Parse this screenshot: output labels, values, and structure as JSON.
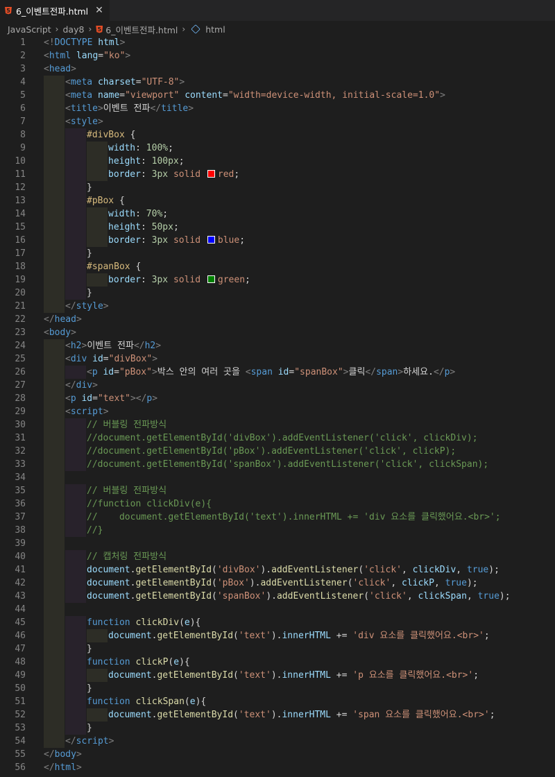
{
  "tab": {
    "filename": "6_이벤트전파.html",
    "icon": "html5-icon",
    "close": "✕"
  },
  "breadcrumb": {
    "items": [
      "JavaScript",
      "day8",
      "6_이벤트전파.html",
      "html"
    ]
  },
  "colors": {
    "red": "#ff0000",
    "blue": "#0000ff",
    "green": "#008000"
  },
  "lines": [
    {
      "n": "1",
      "ind": 0,
      "tokens": [
        [
          "p",
          "<!"
        ],
        [
          "t",
          "DOCTYPE "
        ],
        [
          "a",
          "html"
        ],
        [
          "p",
          ">"
        ]
      ]
    },
    {
      "n": "2",
      "ind": 0,
      "tokens": [
        [
          "p",
          "<"
        ],
        [
          "t",
          "html "
        ],
        [
          "a",
          "lang"
        ],
        [
          "w",
          "="
        ],
        [
          "s",
          "\"ko\""
        ],
        [
          "p",
          ">"
        ]
      ]
    },
    {
      "n": "3",
      "ind": 0,
      "tokens": [
        [
          "p",
          "<"
        ],
        [
          "t",
          "head"
        ],
        [
          "p",
          ">"
        ]
      ]
    },
    {
      "n": "4",
      "ind": 1,
      "tokens": [
        [
          "p",
          "<"
        ],
        [
          "t",
          "meta "
        ],
        [
          "a",
          "charset"
        ],
        [
          "w",
          "="
        ],
        [
          "s",
          "\"UTF-8\""
        ],
        [
          "p",
          ">"
        ]
      ]
    },
    {
      "n": "5",
      "ind": 1,
      "tokens": [
        [
          "p",
          "<"
        ],
        [
          "t",
          "meta "
        ],
        [
          "a",
          "name"
        ],
        [
          "w",
          "="
        ],
        [
          "s",
          "\"viewport\" "
        ],
        [
          "a",
          "content"
        ],
        [
          "w",
          "="
        ],
        [
          "s",
          "\"width=device-width, initial-scale=1.0\""
        ],
        [
          "p",
          ">"
        ]
      ]
    },
    {
      "n": "6",
      "ind": 1,
      "tokens": [
        [
          "p",
          "<"
        ],
        [
          "t",
          "title"
        ],
        [
          "p",
          ">"
        ],
        [
          "w",
          "이벤트 전파"
        ],
        [
          "p",
          "</"
        ],
        [
          "t",
          "title"
        ],
        [
          "p",
          ">"
        ]
      ]
    },
    {
      "n": "7",
      "ind": 1,
      "tokens": [
        [
          "p",
          "<"
        ],
        [
          "t",
          "style"
        ],
        [
          "p",
          ">"
        ]
      ]
    },
    {
      "n": "8",
      "ind": 2,
      "tokens": [
        [
          "sel",
          "#divBox "
        ],
        [
          "w",
          "{"
        ]
      ]
    },
    {
      "n": "9",
      "ind": 3,
      "tokens": [
        [
          "a",
          "width"
        ],
        [
          "w",
          ": "
        ],
        [
          "n",
          "100%"
        ],
        [
          "w",
          ";"
        ]
      ]
    },
    {
      "n": "10",
      "ind": 3,
      "tokens": [
        [
          "a",
          "height"
        ],
        [
          "w",
          ": "
        ],
        [
          "n",
          "100px"
        ],
        [
          "w",
          ";"
        ]
      ]
    },
    {
      "n": "11",
      "ind": 3,
      "tokens": [
        [
          "a",
          "border"
        ],
        [
          "w",
          ": "
        ],
        [
          "n",
          "3px "
        ],
        [
          "s",
          "solid "
        ],
        [
          "sw",
          "red"
        ],
        [
          "s",
          "red"
        ],
        [
          "w",
          ";"
        ]
      ]
    },
    {
      "n": "12",
      "ind": 2,
      "tokens": [
        [
          "w",
          "}"
        ]
      ]
    },
    {
      "n": "13",
      "ind": 2,
      "tokens": [
        [
          "sel",
          "#pBox "
        ],
        [
          "w",
          "{"
        ]
      ]
    },
    {
      "n": "14",
      "ind": 3,
      "tokens": [
        [
          "a",
          "width"
        ],
        [
          "w",
          ": "
        ],
        [
          "n",
          "70%"
        ],
        [
          "w",
          ";"
        ]
      ]
    },
    {
      "n": "15",
      "ind": 3,
      "tokens": [
        [
          "a",
          "height"
        ],
        [
          "w",
          ": "
        ],
        [
          "n",
          "50px"
        ],
        [
          "w",
          ";"
        ]
      ]
    },
    {
      "n": "16",
      "ind": 3,
      "tokens": [
        [
          "a",
          "border"
        ],
        [
          "w",
          ": "
        ],
        [
          "n",
          "3px "
        ],
        [
          "s",
          "solid "
        ],
        [
          "sw",
          "blue"
        ],
        [
          "s",
          "blue"
        ],
        [
          "w",
          ";"
        ]
      ]
    },
    {
      "n": "17",
      "ind": 2,
      "tokens": [
        [
          "w",
          "}"
        ]
      ]
    },
    {
      "n": "18",
      "ind": 2,
      "tokens": [
        [
          "sel",
          "#spanBox "
        ],
        [
          "w",
          "{"
        ]
      ]
    },
    {
      "n": "19",
      "ind": 3,
      "tokens": [
        [
          "a",
          "border"
        ],
        [
          "w",
          ": "
        ],
        [
          "n",
          "3px "
        ],
        [
          "s",
          "solid "
        ],
        [
          "sw",
          "green"
        ],
        [
          "s",
          "green"
        ],
        [
          "w",
          ";"
        ]
      ]
    },
    {
      "n": "20",
      "ind": 2,
      "tokens": [
        [
          "w",
          "}"
        ]
      ]
    },
    {
      "n": "21",
      "ind": 1,
      "tokens": [
        [
          "p",
          "</"
        ],
        [
          "t",
          "style"
        ],
        [
          "p",
          ">"
        ]
      ]
    },
    {
      "n": "22",
      "ind": 0,
      "tokens": [
        [
          "p",
          "</"
        ],
        [
          "t",
          "head"
        ],
        [
          "p",
          ">"
        ]
      ]
    },
    {
      "n": "23",
      "ind": 0,
      "tokens": [
        [
          "p",
          "<"
        ],
        [
          "t",
          "body"
        ],
        [
          "p",
          ">"
        ]
      ]
    },
    {
      "n": "24",
      "ind": 1,
      "tokens": [
        [
          "p",
          "<"
        ],
        [
          "t",
          "h2"
        ],
        [
          "p",
          ">"
        ],
        [
          "w",
          "이벤트 전파"
        ],
        [
          "p",
          "</"
        ],
        [
          "t",
          "h2"
        ],
        [
          "p",
          ">"
        ]
      ]
    },
    {
      "n": "25",
      "ind": 1,
      "tokens": [
        [
          "p",
          "<"
        ],
        [
          "t",
          "div "
        ],
        [
          "a",
          "id"
        ],
        [
          "w",
          "="
        ],
        [
          "s",
          "\"divBox\""
        ],
        [
          "p",
          ">"
        ]
      ]
    },
    {
      "n": "26",
      "ind": 2,
      "tokens": [
        [
          "p",
          "<"
        ],
        [
          "t",
          "p "
        ],
        [
          "a",
          "id"
        ],
        [
          "w",
          "="
        ],
        [
          "s",
          "\"pBox\""
        ],
        [
          "p",
          ">"
        ],
        [
          "w",
          "박스 안의 여러 곳을 "
        ],
        [
          "p",
          "<"
        ],
        [
          "t",
          "span "
        ],
        [
          "a",
          "id"
        ],
        [
          "w",
          "="
        ],
        [
          "s",
          "\"spanBox\""
        ],
        [
          "p",
          ">"
        ],
        [
          "w",
          "클릭"
        ],
        [
          "p",
          "</"
        ],
        [
          "t",
          "span"
        ],
        [
          "p",
          ">"
        ],
        [
          "w",
          "하세요."
        ],
        [
          "p",
          "</"
        ],
        [
          "t",
          "p"
        ],
        [
          "p",
          ">"
        ]
      ]
    },
    {
      "n": "27",
      "ind": 1,
      "tokens": [
        [
          "p",
          "</"
        ],
        [
          "t",
          "div"
        ],
        [
          "p",
          ">"
        ]
      ]
    },
    {
      "n": "28",
      "ind": 1,
      "tokens": [
        [
          "p",
          "<"
        ],
        [
          "t",
          "p "
        ],
        [
          "a",
          "id"
        ],
        [
          "w",
          "="
        ],
        [
          "s",
          "\"text\""
        ],
        [
          "p",
          "></"
        ],
        [
          "t",
          "p"
        ],
        [
          "p",
          ">"
        ]
      ]
    },
    {
      "n": "29",
      "ind": 1,
      "tokens": [
        [
          "p",
          "<"
        ],
        [
          "t",
          "script"
        ],
        [
          "p",
          ">"
        ]
      ]
    },
    {
      "n": "30",
      "ind": 2,
      "tokens": [
        [
          "c",
          "// 버블링 전파방식"
        ]
      ]
    },
    {
      "n": "31",
      "ind": 2,
      "tokens": [
        [
          "c",
          "//document.getElementById('divBox').addEventListener('click', clickDiv);"
        ]
      ]
    },
    {
      "n": "32",
      "ind": 2,
      "tokens": [
        [
          "c",
          "//document.getElementById('pBox').addEventListener('click', clickP);"
        ]
      ]
    },
    {
      "n": "33",
      "ind": 2,
      "tokens": [
        [
          "c",
          "//document.getElementById('spanBox').addEventListener('click', clickSpan);"
        ]
      ]
    },
    {
      "n": "34",
      "ind": 1,
      "tokens": []
    },
    {
      "n": "35",
      "ind": 2,
      "tokens": [
        [
          "c",
          "// 버블링 전파방식"
        ]
      ]
    },
    {
      "n": "36",
      "ind": 2,
      "tokens": [
        [
          "c",
          "//function clickDiv(e){"
        ]
      ]
    },
    {
      "n": "37",
      "ind": 2,
      "tokens": [
        [
          "c",
          "//    document.getElementById('text').innerHTML += 'div 요소를 클릭했어요.<br>';"
        ]
      ]
    },
    {
      "n": "38",
      "ind": 2,
      "tokens": [
        [
          "c",
          "//}"
        ]
      ]
    },
    {
      "n": "39",
      "ind": 1,
      "tokens": []
    },
    {
      "n": "40",
      "ind": 2,
      "tokens": [
        [
          "c",
          "// 캡처링 전파방식"
        ]
      ]
    },
    {
      "n": "41",
      "ind": 2,
      "tokens": [
        [
          "a",
          "document"
        ],
        [
          "w",
          "."
        ],
        [
          "f",
          "getElementById"
        ],
        [
          "w",
          "("
        ],
        [
          "s",
          "'divBox'"
        ],
        [
          "w",
          ")."
        ],
        [
          "f",
          "addEventListener"
        ],
        [
          "w",
          "("
        ],
        [
          "s",
          "'click'"
        ],
        [
          "w",
          ", "
        ],
        [
          "a",
          "clickDiv"
        ],
        [
          "w",
          ", "
        ],
        [
          "t",
          "true"
        ],
        [
          "w",
          ");"
        ]
      ]
    },
    {
      "n": "42",
      "ind": 2,
      "tokens": [
        [
          "a",
          "document"
        ],
        [
          "w",
          "."
        ],
        [
          "f",
          "getElementById"
        ],
        [
          "w",
          "("
        ],
        [
          "s",
          "'pBox'"
        ],
        [
          "w",
          ")."
        ],
        [
          "f",
          "addEventListener"
        ],
        [
          "w",
          "("
        ],
        [
          "s",
          "'click'"
        ],
        [
          "w",
          ", "
        ],
        [
          "a",
          "clickP"
        ],
        [
          "w",
          ", "
        ],
        [
          "t",
          "true"
        ],
        [
          "w",
          ");"
        ]
      ]
    },
    {
      "n": "43",
      "ind": 2,
      "tokens": [
        [
          "a",
          "document"
        ],
        [
          "w",
          "."
        ],
        [
          "f",
          "getElementById"
        ],
        [
          "w",
          "("
        ],
        [
          "s",
          "'spanBox'"
        ],
        [
          "w",
          ")."
        ],
        [
          "f",
          "addEventListener"
        ],
        [
          "w",
          "("
        ],
        [
          "s",
          "'click'"
        ],
        [
          "w",
          ", "
        ],
        [
          "a",
          "clickSpan"
        ],
        [
          "w",
          ", "
        ],
        [
          "t",
          "true"
        ],
        [
          "w",
          ");"
        ]
      ]
    },
    {
      "n": "44",
      "ind": 1,
      "tokens": []
    },
    {
      "n": "45",
      "ind": 2,
      "tokens": [
        [
          "t",
          "function "
        ],
        [
          "f",
          "clickDiv"
        ],
        [
          "w",
          "("
        ],
        [
          "a",
          "e"
        ],
        [
          "w",
          "){"
        ]
      ]
    },
    {
      "n": "46",
      "ind": 3,
      "tokens": [
        [
          "a",
          "document"
        ],
        [
          "w",
          "."
        ],
        [
          "f",
          "getElementById"
        ],
        [
          "w",
          "("
        ],
        [
          "s",
          "'text'"
        ],
        [
          "w",
          ")."
        ],
        [
          "a",
          "innerHTML"
        ],
        [
          "w",
          " += "
        ],
        [
          "s",
          "'div 요소를 클릭했어요.<br>'"
        ],
        [
          "w",
          ";"
        ]
      ]
    },
    {
      "n": "47",
      "ind": 2,
      "tokens": [
        [
          "w",
          "}"
        ]
      ]
    },
    {
      "n": "48",
      "ind": 2,
      "tokens": [
        [
          "t",
          "function "
        ],
        [
          "f",
          "clickP"
        ],
        [
          "w",
          "("
        ],
        [
          "a",
          "e"
        ],
        [
          "w",
          "){"
        ]
      ]
    },
    {
      "n": "49",
      "ind": 3,
      "tokens": [
        [
          "a",
          "document"
        ],
        [
          "w",
          "."
        ],
        [
          "f",
          "getElementById"
        ],
        [
          "w",
          "("
        ],
        [
          "s",
          "'text'"
        ],
        [
          "w",
          ")."
        ],
        [
          "a",
          "innerHTML"
        ],
        [
          "w",
          " += "
        ],
        [
          "s",
          "'p 요소를 클릭했어요.<br>'"
        ],
        [
          "w",
          ";"
        ]
      ]
    },
    {
      "n": "50",
      "ind": 2,
      "tokens": [
        [
          "w",
          "}"
        ]
      ]
    },
    {
      "n": "51",
      "ind": 2,
      "tokens": [
        [
          "t",
          "function "
        ],
        [
          "f",
          "clickSpan"
        ],
        [
          "w",
          "("
        ],
        [
          "a",
          "e"
        ],
        [
          "w",
          "){"
        ]
      ]
    },
    {
      "n": "52",
      "ind": 3,
      "tokens": [
        [
          "a",
          "document"
        ],
        [
          "w",
          "."
        ],
        [
          "f",
          "getElementById"
        ],
        [
          "w",
          "("
        ],
        [
          "s",
          "'text'"
        ],
        [
          "w",
          ")."
        ],
        [
          "a",
          "innerHTML"
        ],
        [
          "w",
          " += "
        ],
        [
          "s",
          "'span 요소를 클릭했어요.<br>'"
        ],
        [
          "w",
          ";"
        ]
      ]
    },
    {
      "n": "53",
      "ind": 2,
      "tokens": [
        [
          "w",
          "}"
        ]
      ]
    },
    {
      "n": "54",
      "ind": 1,
      "tokens": [
        [
          "p",
          "</"
        ],
        [
          "t",
          "script"
        ],
        [
          "p",
          ">"
        ]
      ]
    },
    {
      "n": "55",
      "ind": 0,
      "tokens": [
        [
          "p",
          "</"
        ],
        [
          "t",
          "body"
        ],
        [
          "p",
          ">"
        ]
      ]
    },
    {
      "n": "56",
      "ind": 0,
      "tokens": [
        [
          "p",
          "</"
        ],
        [
          "t",
          "html"
        ],
        [
          "p",
          ">"
        ]
      ]
    }
  ]
}
